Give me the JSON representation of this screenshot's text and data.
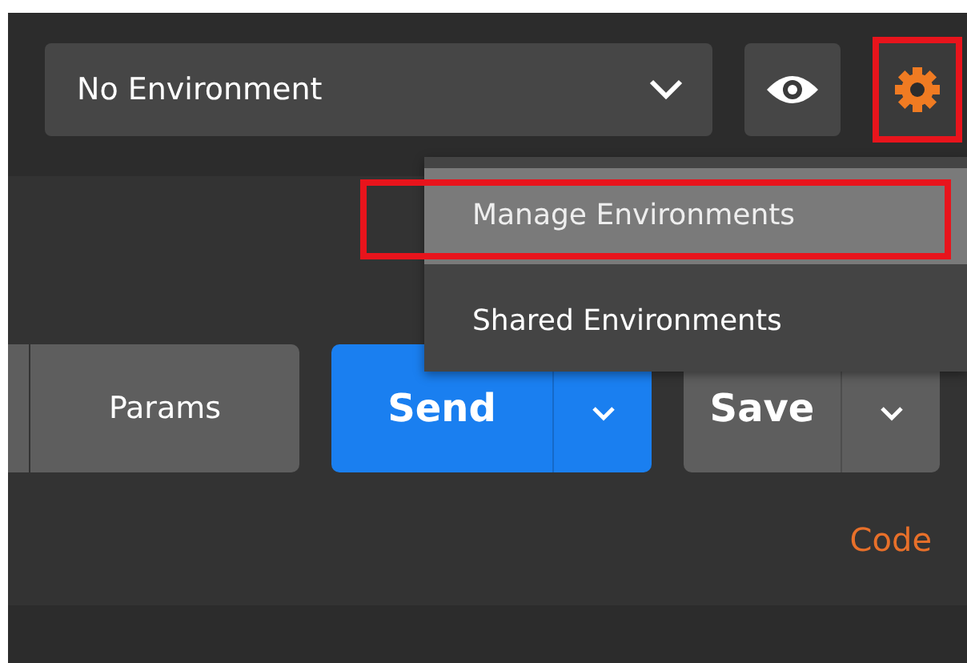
{
  "environment_select": {
    "value": "No Environment"
  },
  "settings_button": {
    "highlighted": true
  },
  "settings_menu": {
    "items": [
      {
        "label": "Manage Environments",
        "selected": true,
        "highlighted": true
      },
      {
        "label": "Shared Environments",
        "selected": false,
        "highlighted": false
      }
    ]
  },
  "request_toolbar": {
    "params_label": "Params",
    "send_label": "Send",
    "save_label": "Save"
  },
  "code_link": "Code"
}
